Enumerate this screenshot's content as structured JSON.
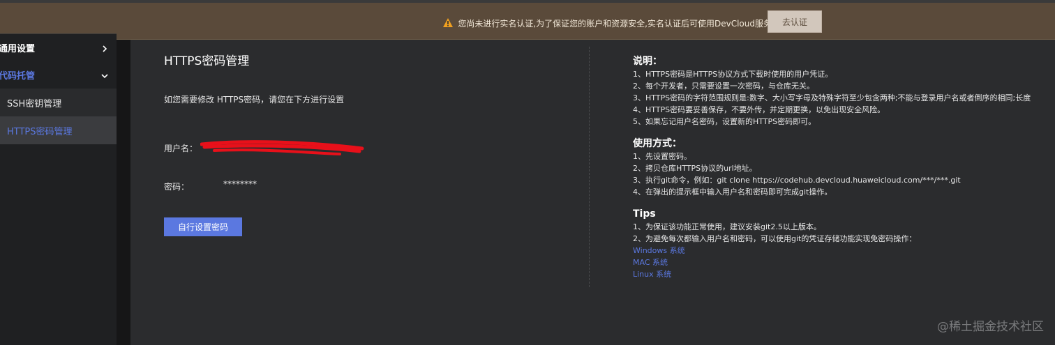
{
  "notice": {
    "text": "您尚未进行实名认证,为了保证您的账户和资源安全,实名认证后可使用DevCloud服务。",
    "button": "去认证",
    "icon": "warning-icon",
    "icon_color": "#f0a020"
  },
  "sidebar": {
    "groups": [
      {
        "label": "通用设置",
        "icon": "chevron-right-icon"
      },
      {
        "label": "代码托管",
        "icon": "chevron-down-icon"
      }
    ],
    "items": [
      {
        "label": "SSH密钥管理"
      },
      {
        "label": "HTTPS密码管理"
      }
    ]
  },
  "main": {
    "title": "HTTPS密码管理",
    "hint": "如您需要修改 HTTPS密码，请您在下方进行设置",
    "username_label": "用户名：",
    "password_label": "密码：",
    "password_value": "********",
    "set_button": "自行设置密码"
  },
  "info": {
    "desc_title": "说明：",
    "desc_lines": [
      "1、HTTPS密码是HTTPS协议方式下载时使用的用户凭证。",
      "2、每个开发者，只需要设置一次密码，与仓库无关。",
      "3、HTTPS密码的字符范围规则是:数字、大小写字母及特殊字符至少包含两种;不能与登录用户名或者倒序的相同;长度",
      "4、HTTPS密码要妥善保存，不要外传，并定期更换，以免出现安全风险。",
      "5、如果忘记用户名密码，设置新的HTTPS密码即可。"
    ],
    "usage_title": "使用方式：",
    "usage_lines": [
      "1、先设置密码。",
      "2、拷贝仓库HTTPS协议的url地址。",
      "3、执行git命令，例如：git clone https://codehub.devcloud.huaweicloud.com/***/***.git",
      "4、在弹出的提示框中输入用户名和密码即可完成git操作。"
    ],
    "tips_title": "Tips",
    "tips_lines": [
      "1、为保证该功能正常使用，建议安装git2.5以上版本。",
      "2、为避免每次都输入用户名和密码，可以使用git的凭证存储功能实现免密码操作："
    ],
    "links": [
      "Windows 系统",
      "MAC 系统",
      "Linux 系统"
    ]
  },
  "watermark": "@稀土掘金技术社区",
  "colors": {
    "accent": "#5b78e0",
    "topbar": "#5a4a3a",
    "background": "#2b2c2e"
  }
}
